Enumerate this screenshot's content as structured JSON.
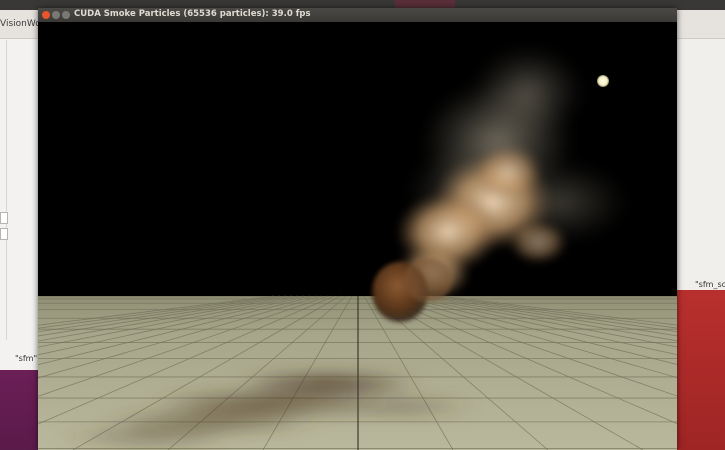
{
  "window": {
    "title": "CUDA Smoke Particles (65536 particles): 39.0 fps"
  },
  "background_windows": {
    "left_title": "VisionWork",
    "left_file_label": "\"sfm\"",
    "right_file_label": "\"sfm_scr"
  },
  "colors": {
    "titlebar": "#3a3936",
    "close_button": "#e9552a",
    "floor": "#b9b89c",
    "smoke": "#d9b48a",
    "light": "#f6f0c8",
    "desktop_purple": "#6b1f56",
    "desktop_red": "#b8302e"
  },
  "icons": [
    "close-icon",
    "minimize-icon",
    "maximize-icon"
  ]
}
